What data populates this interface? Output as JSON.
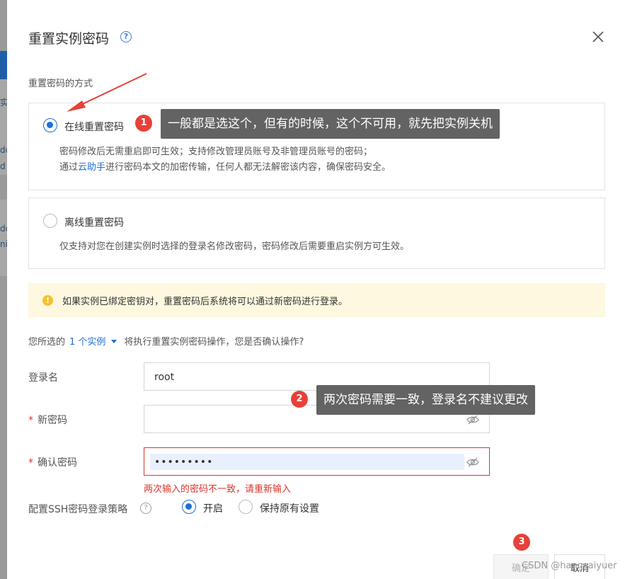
{
  "background": {
    "text_1": "实",
    "text_2": "do",
    "text_3": "d",
    "text_4": "do",
    "text_5": "ni"
  },
  "dialog": {
    "title": "重置实例密码",
    "help_glyph": "?",
    "section_label": "重置密码的方式",
    "online": {
      "title": "在线重置密码",
      "desc_line1": "密码修改后无需重启即可生效；支持修改管理员账号及非管理员账号的密码；",
      "desc_line2_prefix": "通过",
      "desc_line2_link": "云助手",
      "desc_line2_suffix": "进行密码本文的加密传输，任何人都无法解密该内容，确保密码安全。"
    },
    "offline": {
      "title": "离线重置密码",
      "desc": "仅支持对您在创建实例时选择的登录名修改密码，密码修改后需要重启实例方可生效。"
    },
    "warning": "如果实例已绑定密钥对，重置密码后系统将可以通过新密码进行登录。",
    "warning_glyph": "!",
    "confirm": {
      "prefix": "您所选的",
      "selection": "1 个实例",
      "suffix": "将执行重置实例密码操作，您是否确认操作?"
    },
    "form": {
      "login_label": "登录名",
      "login_value": "root",
      "new_password_label": "新密码",
      "new_password_value": "",
      "confirm_password_label": "确认密码",
      "confirm_password_value": "•••••••••",
      "required_mark": "*",
      "error_message": "两次输入的密码不一致，请重新输入"
    },
    "ssh": {
      "label": "配置SSH密码登录策略",
      "help_glyph": "?",
      "option_on": "开启",
      "option_keep": "保持原有设置"
    },
    "buttons": {
      "ok": "确定",
      "cancel": "取消"
    }
  },
  "annotations": {
    "badge_1": "1",
    "callout_1": "一般都是选这个，但有的时候，这个不可用，就先把实例关机",
    "badge_2": "2",
    "callout_2": "两次密码需要一致，登录名不建议更改",
    "badge_3": "3"
  },
  "watermark": "CSDN @hangsaiyuer",
  "colors": {
    "accent": "#1f6fd6",
    "error": "#d9342b",
    "badge": "#e8403a",
    "callout_bg": "#636363",
    "warning_bg": "#fdf8df"
  }
}
